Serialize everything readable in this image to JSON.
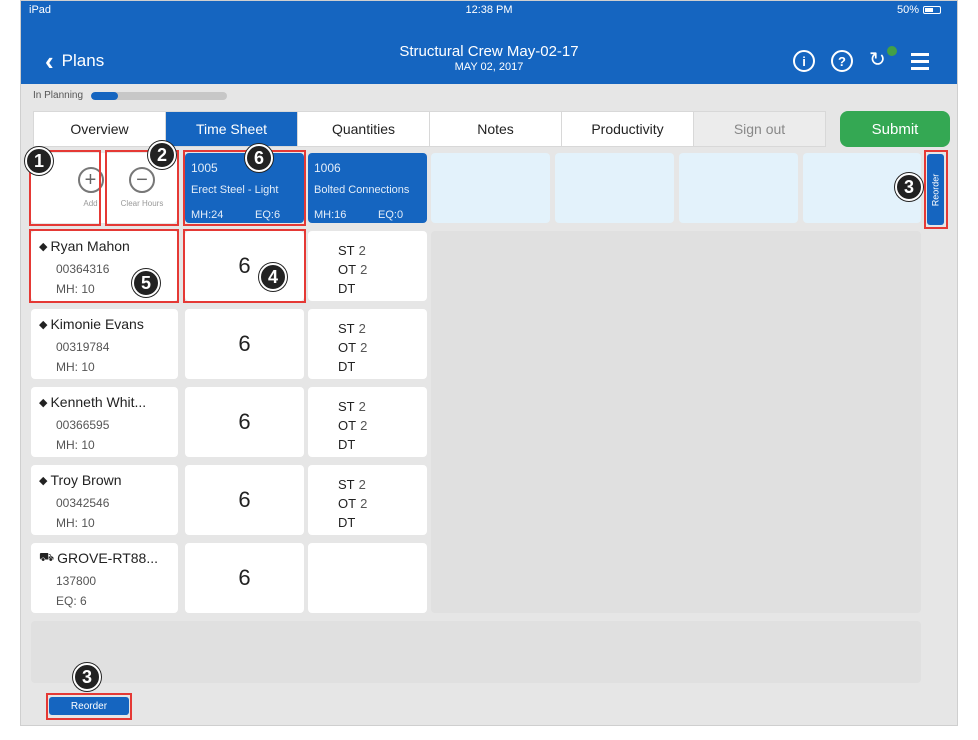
{
  "status_bar": {
    "device": "iPad",
    "time": "12:38 PM",
    "battery": "50%"
  },
  "header": {
    "back_label": "Plans",
    "title": "Structural Crew May-02-17",
    "subtitle": "MAY 02, 2017",
    "info_icon": "info-icon",
    "help_icon": "help-icon",
    "sync_icon": "sync-icon",
    "menu_icon": "hamburger-menu-icon"
  },
  "planning": {
    "label": "In Planning",
    "progress": 0.2
  },
  "tabs": [
    {
      "label": "Overview"
    },
    {
      "label": "Time Sheet"
    },
    {
      "label": "Quantities"
    },
    {
      "label": "Notes"
    },
    {
      "label": "Productivity"
    },
    {
      "label": "Sign out"
    }
  ],
  "submit_label": "Submit",
  "tools": {
    "add_label": "Add",
    "clear_label": "Clear Hours"
  },
  "tasks": [
    {
      "id": "1005",
      "name": "Erect Steel - Light",
      "mh": "MH:24",
      "eq": "EQ:6"
    },
    {
      "id": "1006",
      "name": "Bolted Connections",
      "mh": "MH:16",
      "eq": "EQ:0"
    }
  ],
  "crew": [
    {
      "name": "Ryan Mahon",
      "number": "00364316",
      "meta": "MH: 10",
      "hours": "6",
      "type": "worker"
    },
    {
      "name": "Kimonie Evans",
      "number": "00319784",
      "meta": "MH: 10",
      "hours": "6",
      "type": "worker"
    },
    {
      "name": "Kenneth Whit...",
      "number": "00366595",
      "meta": "MH: 10",
      "hours": "6",
      "type": "worker"
    },
    {
      "name": "Troy Brown",
      "number": "00342546",
      "meta": "MH: 10",
      "hours": "6",
      "type": "worker"
    },
    {
      "name": "GROVE-RT88...",
      "number": "137800",
      "meta": "EQ:  6",
      "hours": "6",
      "type": "equipment"
    }
  ],
  "hour_labels": {
    "st": "ST",
    "ot": "OT",
    "dt": "DT",
    "st_value": "2",
    "ot_value": "2"
  },
  "reorder_label": "Reorder",
  "callouts": {
    "one": "1",
    "two": "2",
    "three": "3",
    "four": "4",
    "five": "5",
    "six": "6"
  },
  "colors": {
    "header_blue": "#1565c0",
    "submit_green": "#34a853",
    "highlight_red": "#e53935"
  }
}
